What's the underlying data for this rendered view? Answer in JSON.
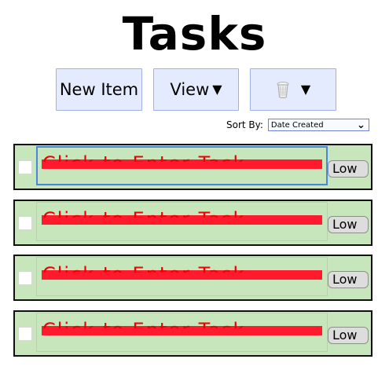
{
  "title": "Tasks",
  "toolbar": {
    "new_item_label": "New Item",
    "view_label": "View",
    "view_caret": "▼",
    "delete_caret": "▼",
    "delete_icon": "trash-icon"
  },
  "sort": {
    "label": "Sort By:",
    "selected": "Date Created",
    "chevron": "⌄"
  },
  "tasks": [
    {
      "placeholder": "Click to Enter Task",
      "priority": "Low"
    },
    {
      "placeholder": "Click to Enter Task",
      "priority": "Low"
    },
    {
      "placeholder": "Click to Enter Task",
      "priority": "Low"
    },
    {
      "placeholder": "Click to Enter Task",
      "priority": "Low"
    }
  ],
  "colors": {
    "toolbar_button_bg": "#e5ebff",
    "toolbar_button_border": "#9fb2e8",
    "task_row_bg": "#c8e6bb",
    "task_red": "#ff1a2d",
    "focus_blue": "#4a87d8"
  }
}
